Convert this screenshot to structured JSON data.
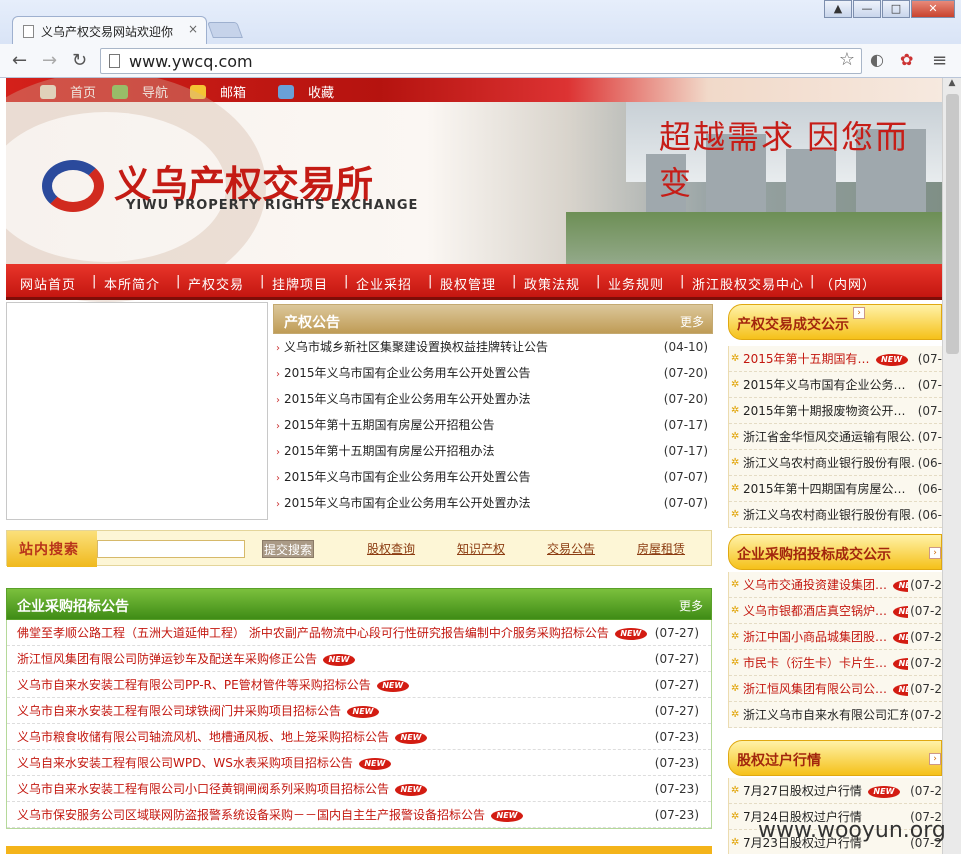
{
  "browser": {
    "tab_title": "义乌产权交易网站欢迎你",
    "tab_close": "×",
    "url": "www.ywcq.com",
    "window_buttons": [
      "▲",
      "—",
      "□",
      "✕"
    ],
    "nav": {
      "back": "←",
      "forward": "→",
      "reload": "↻",
      "star": "☆",
      "menu": "≡"
    }
  },
  "site": {
    "topbar": [
      "首页",
      "导航",
      "邮箱",
      "收藏"
    ],
    "slogan": "超越需求  因您而变",
    "logo_cn": "义乌产权交易所",
    "logo_en": "YIWU PROPERTY RIGHTS EXCHANGE",
    "mainnav": [
      "网站首页",
      "本所简介",
      "产权交易",
      "挂牌项目",
      "企业采招",
      "股权管理",
      "政策法规",
      "业务规则",
      "浙江股权交易中心",
      "（内网）"
    ],
    "nav_sep": "|"
  },
  "notice": {
    "title": "产权公告",
    "more": "更多",
    "items": [
      {
        "text": "义乌市城乡新社区集聚建设置换权益挂牌转让公告",
        "date": "(04-10)"
      },
      {
        "text": "2015年义乌市国有企业公务用车公开处置公告",
        "date": "(07-20)"
      },
      {
        "text": "2015年义乌市国有企业公务用车公开处置办法",
        "date": "(07-20)"
      },
      {
        "text": "2015年第十五期国有房屋公开招租公告",
        "date": "(07-17)"
      },
      {
        "text": "2015年第十五期国有房屋公开招租办法",
        "date": "(07-17)"
      },
      {
        "text": "2015年义乌市国有企业公务用车公开处置公告",
        "date": "(07-07)"
      },
      {
        "text": "2015年义乌市国有企业公务用车公开处置办法",
        "date": "(07-07)"
      }
    ]
  },
  "search": {
    "label": "站内搜索",
    "button": "提交搜索",
    "links": [
      "股权查询",
      "知识产权",
      "交易公告",
      "房屋租赁"
    ]
  },
  "procurement": {
    "title": "企业采购招标公告",
    "more": "更多",
    "new_label": "NEW",
    "items": [
      {
        "text": "佛堂至孝顺公路工程（五洲大道延伸工程） 浙中农副产品物流中心段可行性研究报告编制中介服务采购招标公告",
        "date": "(07-27)"
      },
      {
        "text": "浙江恒风集团有限公司防弹运钞车及配送车采购修正公告",
        "date": "(07-27)"
      },
      {
        "text": "义乌市自来水安装工程有限公司PP-R、PE管材管件等采购招标公告",
        "date": "(07-27)"
      },
      {
        "text": "义乌市自来水安装工程有限公司球铁阀门井采购项目招标公告",
        "date": "(07-27)"
      },
      {
        "text": "义乌市粮食收储有限公司轴流风机、地槽通风板、地上笼采购招标公告",
        "date": "(07-23)"
      },
      {
        "text": "义乌自来水安装工程有限公司WPD、WS水表采购项目招标公告",
        "date": "(07-23)"
      },
      {
        "text": "义乌市自来水安装工程有限公司小口径黄铜闸阀系列采购项目招标公告",
        "date": "(07-23)"
      },
      {
        "text": "义乌市保安服务公司区域联网防盗报警系统设备采购－－国内自主生产报警设备招标公告",
        "date": "(07-23)"
      }
    ]
  },
  "deals": {
    "title": "产权交易成交公示",
    "items": [
      {
        "text": "2015年第十五期国有…",
        "date": "(07-",
        "new": true
      },
      {
        "text": "2015年义乌市国有企业公务…",
        "date": "(07-"
      },
      {
        "text": "2015年第十期报废物资公开…",
        "date": "(07-"
      },
      {
        "text": "浙江省金华恒风交通运输有限公…",
        "date": "(07-"
      },
      {
        "text": "浙江义乌农村商业银行股份有限…",
        "date": "(06-"
      },
      {
        "text": "2015年第十四期国有房屋公…",
        "date": "(06-"
      },
      {
        "text": "浙江义乌农村商业银行股份有限…",
        "date": "(06-"
      }
    ]
  },
  "bids": {
    "title": "企业采购招投标成交公示",
    "items": [
      {
        "text": "义乌市交通投资建设集团…",
        "date": "(07-2",
        "new": true
      },
      {
        "text": "义乌市银都酒店真空锅炉…",
        "date": "(07-2",
        "new": true
      },
      {
        "text": "浙江中国小商品城集团股…",
        "date": "(07-2",
        "new": true
      },
      {
        "text": "市民卡（衍生卡）卡片生…",
        "date": "(07-2",
        "new": true
      },
      {
        "text": "浙江恒风集团有限公司公…",
        "date": "(07-2",
        "new": true
      },
      {
        "text": "浙江义乌市自来水有限公司汇东…",
        "date": "(07-2"
      }
    ]
  },
  "equity": {
    "title": "股权过户行情",
    "items": [
      {
        "text": "7月27日股权过户行情",
        "date": "(07-2",
        "new": true
      },
      {
        "text": "7月24日股权过户行情",
        "date": "(07-2"
      },
      {
        "text": "7月23日股权过户行情",
        "date": "(07-2"
      }
    ]
  },
  "watermark": "www.wooyun.org"
}
